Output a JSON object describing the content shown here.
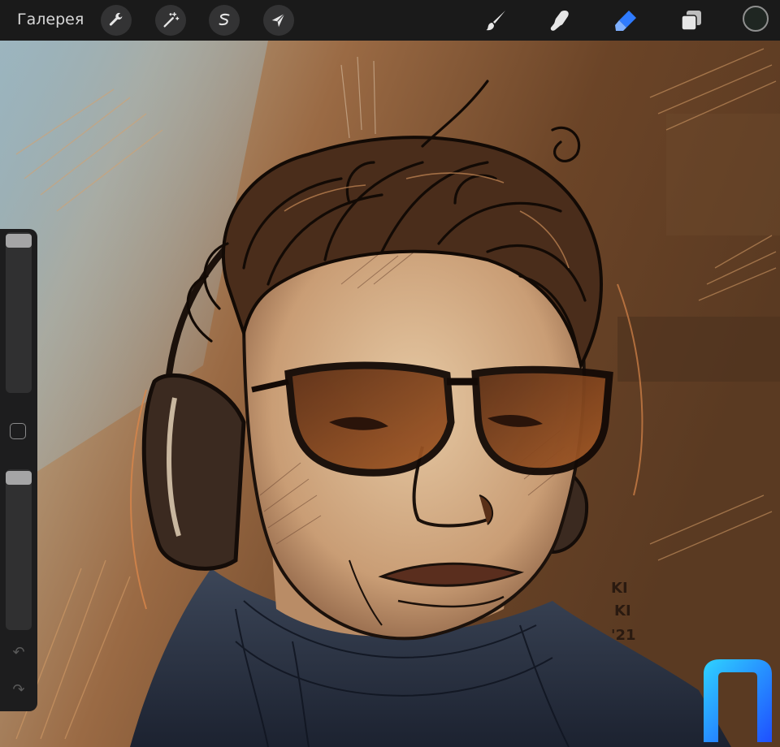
{
  "toolbar": {
    "gallery_label": "Галерея",
    "actions_icon": "wrench-icon",
    "adjustments_icon": "magic-wand-icon",
    "selection_icon": "selection-icon",
    "transform_icon": "arrow-cursor-icon",
    "brush_icon": "brush-icon",
    "smudge_icon": "smudge-finger-icon",
    "eraser_icon": "eraser-icon",
    "layers_icon": "layers-icon",
    "active_tool": "eraser",
    "current_color": "#1f2622",
    "accent_color": "#2f7bff"
  },
  "sidebar": {
    "brush_size_level": 0.98,
    "opacity_level": 0.98,
    "modify_icon": "square-icon",
    "undo_icon": "undo-icon",
    "redo_icon": "redo-icon"
  },
  "canvas": {
    "signature": "KI KI '21"
  },
  "logo": {
    "icon": "blue-arch-logo-icon"
  }
}
